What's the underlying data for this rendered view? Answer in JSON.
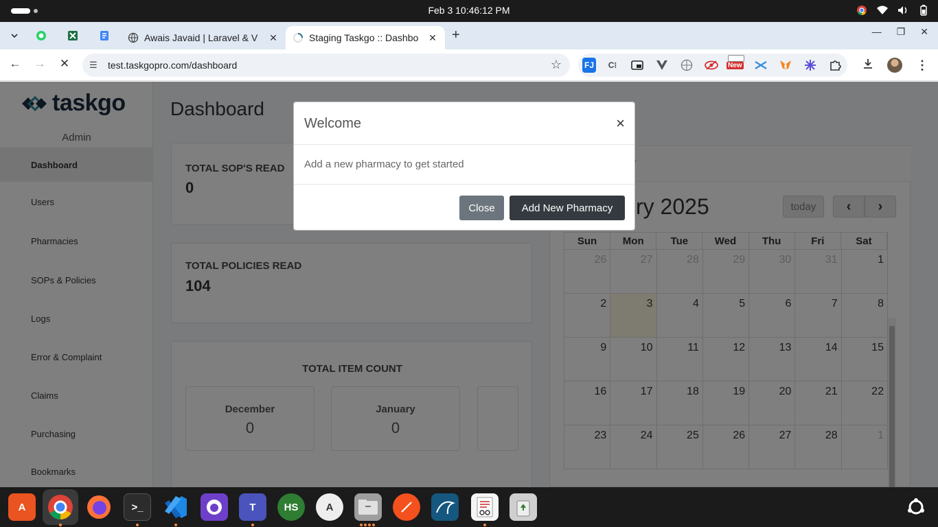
{
  "os": {
    "clock": "Feb 3  10:46:12 PM"
  },
  "browser": {
    "tabs": [
      {
        "title": "Awais Javaid | Laravel & V",
        "active": false
      },
      {
        "title": "Staging Taskgo :: Dashbo",
        "active": true
      }
    ],
    "url": "test.taskgopro.com/dashboard",
    "extension_badge": "New"
  },
  "app": {
    "logo_text": "taskgo",
    "role": "Admin",
    "sidebar": [
      {
        "label": "Dashboard",
        "active": true
      },
      {
        "label": "Users"
      },
      {
        "label": "Pharmacies"
      },
      {
        "label": "SOPs & Policies"
      },
      {
        "label": "Logs"
      },
      {
        "label": "Error & Complaint"
      },
      {
        "label": "Claims"
      },
      {
        "label": "Purchasing"
      },
      {
        "label": "Bookmarks"
      }
    ],
    "page_title": "Dashboard",
    "cards": {
      "sops": {
        "label": "TOTAL SOP'S READ",
        "value": "0"
      },
      "policies": {
        "label": "TOTAL POLICIES READ",
        "value": "104"
      },
      "items": {
        "label": "TOTAL ITEM COUNT",
        "months": [
          {
            "name": "December",
            "value": "0"
          },
          {
            "name": "January",
            "value": "0"
          }
        ]
      }
    },
    "calendar": {
      "header": "ar",
      "title": "ry 2025",
      "today_label": "today",
      "prev": "‹",
      "next": "›",
      "dow": [
        "Sun",
        "Mon",
        "Tue",
        "Wed",
        "Thu",
        "Fri",
        "Sat"
      ],
      "weeks": [
        [
          "26",
          "27",
          "28",
          "29",
          "30",
          "31",
          "1"
        ],
        [
          "2",
          "3",
          "4",
          "5",
          "6",
          "7",
          "8"
        ],
        [
          "9",
          "10",
          "11",
          "12",
          "13",
          "14",
          "15"
        ],
        [
          "16",
          "17",
          "18",
          "19",
          "20",
          "21",
          "22"
        ],
        [
          "23",
          "24",
          "25",
          "26",
          "27",
          "28",
          "1"
        ]
      ],
      "other_month_first_row": 6,
      "today_cell": [
        1,
        1
      ]
    }
  },
  "modal": {
    "title": "Welcome",
    "close_x": "×",
    "body": "Add a new pharmacy to get started",
    "close_button": "Close",
    "primary_button": "Add New Pharmacy"
  }
}
